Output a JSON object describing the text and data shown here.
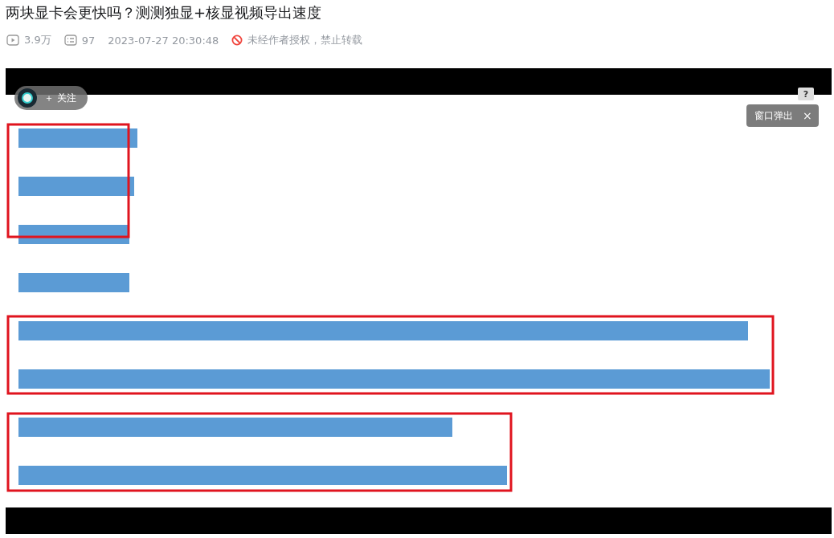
{
  "video": {
    "title": "两块显卡会更快吗？测测独显+核显视频导出速度",
    "views": "3.9万",
    "comments": "97",
    "datetime": "2023-07-27 20:30:48",
    "notice": "未经作者授权，禁止转载"
  },
  "player": {
    "kind": "picture",
    "follow_button": "＋ 关注",
    "help_button": "?",
    "popup": {
      "label": "窗口弹出",
      "close": "×"
    }
  }
}
